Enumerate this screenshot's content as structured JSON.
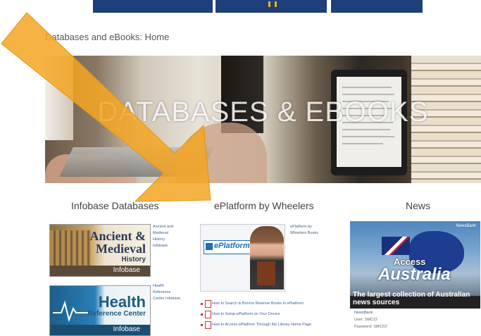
{
  "breadcrumb": "Databases and eBooks: Home",
  "hero": {
    "title": "DATABASES & EBOOKS"
  },
  "columns": {
    "infobase": {
      "title": "Infobase Databases",
      "ancient": {
        "line1": "Ancient &",
        "line2": "Medieval",
        "line3": "History",
        "brand": "Infobase",
        "links": [
          "Ancient and",
          "Medieval",
          "History",
          "Infobase"
        ]
      },
      "health": {
        "line1": "Health",
        "line2": "Reference Center",
        "brand": "Infobase",
        "links": [
          "Health",
          "Reference",
          "Center Infobase"
        ]
      }
    },
    "eplatform": {
      "title": "ePlatform by Wheelers",
      "logo_text": "ePlatform",
      "side_link": "ePlatform by Wheelers Books",
      "how_to": [
        "How to Search & Borrow Reserve Books in ePlatform",
        "How to Setup ePlatform on Your Device",
        "How to Access ePlatform Through the Library Home Page"
      ]
    },
    "news": {
      "title": "News",
      "brand": "NewsBank",
      "access": "Access",
      "australia": "Australia",
      "caption": "The largest collection of Australian news sources",
      "info": {
        "name": "NewsBank",
        "user": "User: SMC22",
        "password": "Password: SMC22!"
      }
    }
  },
  "colors": {
    "nav_blue": "#1e3f7a",
    "arrow_orange": "#f5a623",
    "link_blue": "#3b5e9c"
  }
}
